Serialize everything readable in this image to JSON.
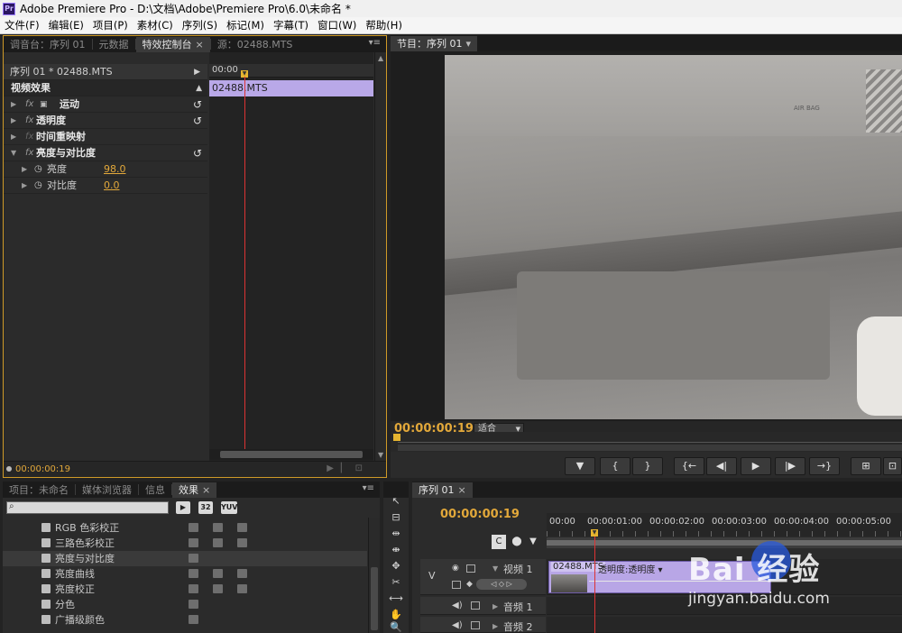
{
  "window": {
    "app_icon": "Pr",
    "title": "Adobe Premiere Pro - D:\\文档\\Adobe\\Premiere Pro\\6.0\\未命名 *"
  },
  "menu": [
    "文件(F)",
    "编辑(E)",
    "项目(P)",
    "素材(C)",
    "序列(S)",
    "标记(M)",
    "字幕(T)",
    "窗口(W)",
    "帮助(H)"
  ],
  "source_panel": {
    "tabs": [
      "调音台：序列 01",
      "元数据",
      "特效控制台",
      "源：02488.MTS"
    ],
    "active_tab": "特效控制台",
    "menu_icon": "▾≡"
  },
  "effect_controls": {
    "sequence_label": "序列 01 * 02488.MTS",
    "section_title": "视频效果",
    "timecode_ruler_start": "00:00",
    "clip_name": "02488.MTS",
    "effects": [
      {
        "name": "运动",
        "has_box_icon": true,
        "reset": true
      },
      {
        "name": "透明度",
        "has_box_icon": false,
        "reset": true
      },
      {
        "name": "时间重映射",
        "has_box_icon": false,
        "reset": false
      },
      {
        "name": "亮度与对比度",
        "has_box_icon": false,
        "reset": true
      }
    ],
    "params": [
      {
        "name": "亮度",
        "value": "98.0"
      },
      {
        "name": "对比度",
        "value": "0.0"
      }
    ],
    "footer_timecode": "00:00:00:19"
  },
  "program_monitor": {
    "tab": "节目：序列 01",
    "timecode": "00:00:00:19",
    "fit_value": "适合",
    "frame_text": "AIR BAG",
    "controls": [
      "▼",
      "{",
      "}",
      "{←",
      "◀|",
      "▶",
      "|▶",
      "→}",
      "⊞",
      "⊡"
    ]
  },
  "project_panel": {
    "tabs": [
      "项目：未命名",
      "媒体浏览器",
      "信息",
      "效果"
    ],
    "active_tab": "效果",
    "badges": [
      "▶",
      "32",
      "YUV"
    ],
    "search_placeholder": "",
    "effects_list": [
      {
        "name": "RGB 色彩校正",
        "acc": 3,
        "highlighted": false
      },
      {
        "name": "三路色彩校正",
        "acc": 3,
        "highlighted": false
      },
      {
        "name": "亮度与对比度",
        "acc": 1,
        "highlighted": true
      },
      {
        "name": "亮度曲线",
        "acc": 3,
        "highlighted": false
      },
      {
        "name": "亮度校正",
        "acc": 3,
        "highlighted": false
      },
      {
        "name": "分色",
        "acc": 1,
        "highlighted": false
      },
      {
        "name": "广播级颜色",
        "acc": 1,
        "highlighted": false
      }
    ]
  },
  "tools": [
    "↖",
    "⊟",
    "⇹",
    "⇼",
    "✥",
    "✂",
    "⟷",
    "✋",
    "🔍"
  ],
  "timeline": {
    "tab": "序列 01",
    "timecode": "00:00:00:19",
    "ruler_labels": [
      "00:00",
      "00:00:01:00",
      "00:00:02:00",
      "00:00:03:00",
      "00:00:04:00",
      "00:00:05:00"
    ],
    "tracks": {
      "video": {
        "name": "视频 1",
        "v_label": "V"
      },
      "audio1": {
        "name": "音频 1"
      },
      "audio2": {
        "name": "音频 2"
      }
    },
    "clip": {
      "name": "02488.MTS",
      "opacity_label": "透明度:透明度 ▾"
    }
  },
  "watermark": {
    "brand": "Bai  经验",
    "url": "jingyan.baidu.com"
  }
}
